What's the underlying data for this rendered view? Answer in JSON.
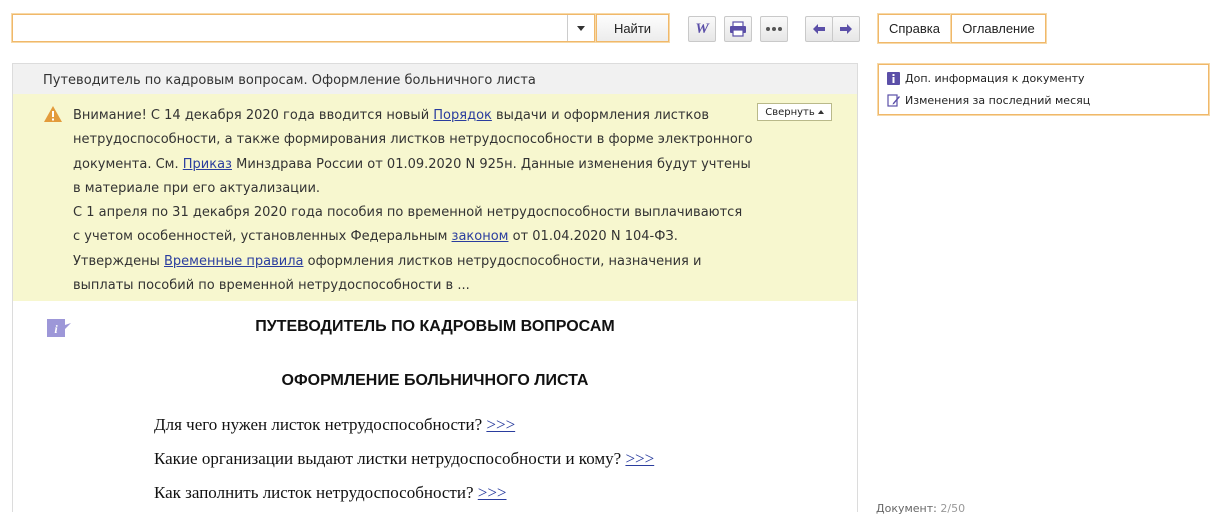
{
  "toolbar": {
    "search_value": "",
    "find_label": "Найти",
    "help_tab": "Справка",
    "toc_tab": "Оглавление",
    "word_glyph": "W"
  },
  "document": {
    "title": "Путеводитель по кадровым вопросам. Оформление больничного листа",
    "collapse_label": "Свернуть",
    "notice": {
      "p1_a": "Внимание! С 14 декабря 2020 года вводится новый ",
      "p1_link1": "Порядок",
      "p1_b": " выдачи и оформления листков нетрудоспособности, а также формирования листков нетрудоспособности в форме электронного документа. См. ",
      "p1_link2": "Приказ",
      "p1_c": " Минздрава России от 01.09.2020 N 925н. Данные изменения будут учтены в материале при его актуализации.",
      "p2_a": "С 1 апреля по 31 декабря 2020 года пособия по временной нетрудоспособности выплачиваются с учетом особенностей, установленных Федеральным ",
      "p2_link": "законом",
      "p2_b": " от 01.04.2020 N 104-ФЗ.",
      "p3_a": "Утверждены ",
      "p3_link": "Временные правила",
      "p3_b": " оформления листков нетрудоспособности, назначения и выплаты пособий по временной нетрудоспособности в ..."
    },
    "heading1": "ПУТЕВОДИТЕЛЬ ПО КАДРОВЫМ ВОПРОСАМ",
    "heading2": "ОФОРМЛЕНИЕ БОЛЬНИЧНОГО ЛИСТА",
    "questions": [
      {
        "text": "Для чего нужен листок нетрудоспособности? ",
        "link": ">>>"
      },
      {
        "text": "Какие организации выдают листки нетрудоспособности и кому? ",
        "link": ">>>"
      },
      {
        "text": "Как заполнить листок нетрудоспособности? ",
        "link": ">>>"
      }
    ]
  },
  "side_panel": {
    "item1": "Доп. информация к документу",
    "item2": "Изменения за последний месяц"
  },
  "status": {
    "label": "Документ: ",
    "value": "2/50"
  },
  "colors": {
    "accent_border": "#f0b86a",
    "notice_bg": "#f7f7cf",
    "icon_purple": "#5b4fa8",
    "link": "#2a3d9e"
  }
}
